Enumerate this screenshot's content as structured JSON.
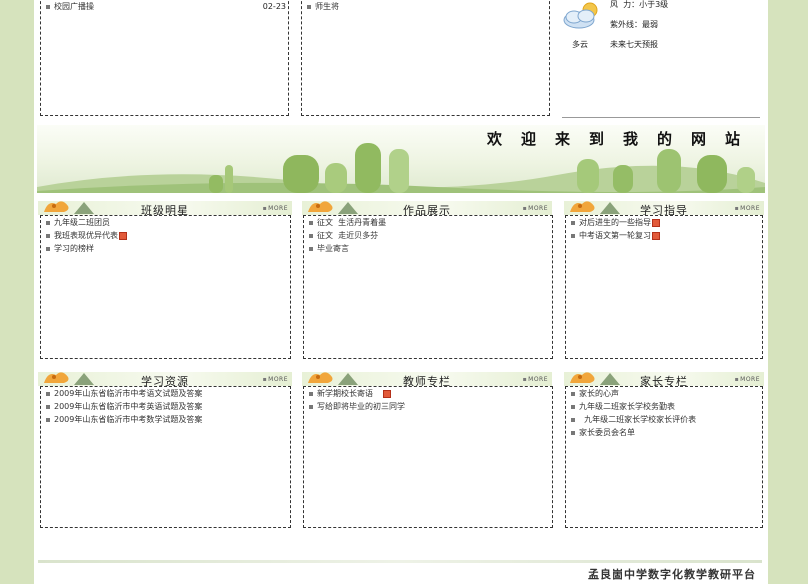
{
  "top_left": {
    "news": {
      "title": "校园广播操",
      "date": "02-23"
    }
  },
  "top_middle": {
    "news": {
      "title": "师生将"
    }
  },
  "weather": {
    "wind": "风  力：小于3级",
    "uv": "紫外线：最弱",
    "condition": "多云",
    "forecast_link": "未来七天预报"
  },
  "banner": {
    "welcome": "欢迎来到我的网站"
  },
  "more_label": "MORE",
  "panels": [
    {
      "title": "班级明星",
      "items": [
        {
          "text": "九年级二班团员"
        },
        {
          "text": "我班表现优异代表",
          "new": true
        },
        {
          "text": "学习的榜样"
        }
      ]
    },
    {
      "title": "作品展示",
      "items": [
        {
          "text": "征文  生活丹青着墨"
        },
        {
          "text": "征文  走近贝多芬"
        },
        {
          "text": "毕业寄言"
        }
      ]
    },
    {
      "title": "学习指导",
      "items": [
        {
          "text": "对后进生的一些指导",
          "new": true
        },
        {
          "text": "中考语文第一轮复习",
          "new": true
        }
      ]
    },
    {
      "title": "学习资源",
      "items": [
        {
          "text": "2009年山东省临沂市中考语文试题及答案"
        },
        {
          "text": "2009年山东省临沂市中考英语试题及答案"
        },
        {
          "text": "2009年山东省临沂市中考数学试题及答案"
        }
      ]
    },
    {
      "title": "教师专栏",
      "items": [
        {
          "text": "新学期校长寄语",
          "new": true
        },
        {
          "text": "写给即将毕业的初三同学"
        }
      ]
    },
    {
      "title": "家长专栏",
      "items": [
        {
          "text": "家长的心声"
        },
        {
          "text": "九年级二班家长学校务勤表"
        },
        {
          "text": "  九年级二班家长学校家长评价表"
        },
        {
          "text": "家长委员会名单"
        }
      ]
    }
  ],
  "footer": {
    "title": "孟良崮中学数字化教学教研平台"
  }
}
